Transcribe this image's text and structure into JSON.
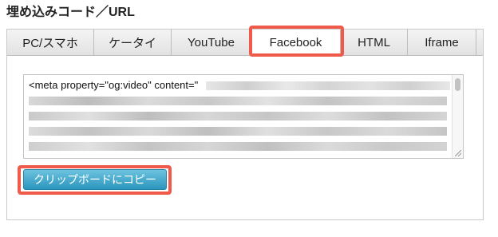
{
  "section": {
    "title": "埋め込みコード／URL"
  },
  "tabs": [
    {
      "label": "PC/スマホ",
      "active": false
    },
    {
      "label": "ケータイ",
      "active": false
    },
    {
      "label": "YouTube",
      "active": false
    },
    {
      "label": "Facebook",
      "active": true
    },
    {
      "label": "HTML",
      "active": false
    },
    {
      "label": "Iframe",
      "active": false
    }
  ],
  "code": {
    "first_line": "<meta property=\"og:video\" content=\""
  },
  "copy_button": {
    "label": "クリップボードにコピー"
  },
  "colors": {
    "highlight": "#f05a4a",
    "button_top": "#6cc3df",
    "button_bottom": "#2b95bd"
  }
}
